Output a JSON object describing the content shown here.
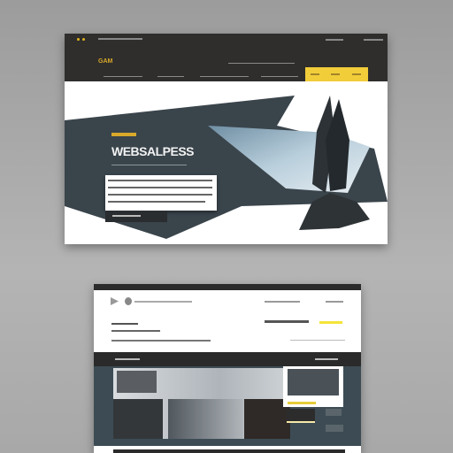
{
  "top_mockup": {
    "logo": "GAM",
    "headline": "WEBSALPESS",
    "accent": "#f1cd3a",
    "dark": "#2f2e2c",
    "slate": "#3a444b"
  },
  "bottom_mockup": {
    "accent": "#f4e43a"
  }
}
